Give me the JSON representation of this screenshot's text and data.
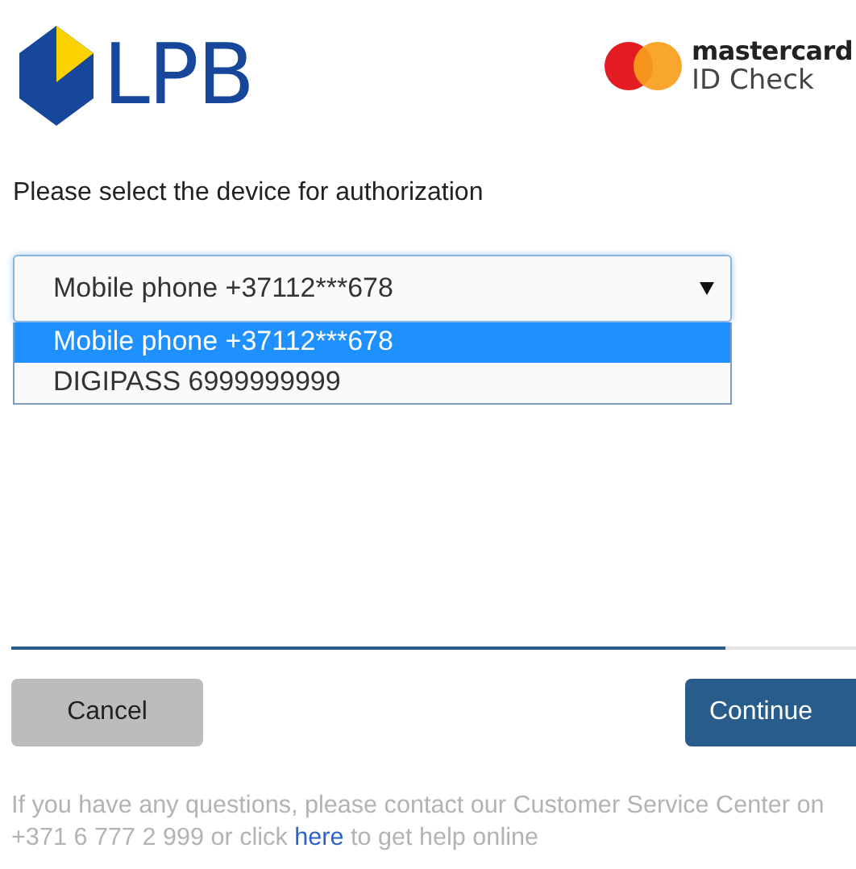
{
  "header": {
    "bank_logo": "LPB",
    "scheme_name": "mastercard",
    "scheme_product": "ID Check"
  },
  "prompt": "Please select the device for authorization",
  "device_select": {
    "value": "Mobile phone +37112***678",
    "expanded": true,
    "options": [
      {
        "label": "Mobile phone +37112***678",
        "selected": true
      },
      {
        "label": "DIGIPASS 6999999999",
        "selected": false
      }
    ]
  },
  "progress": {
    "level": 0.845
  },
  "buttons": {
    "cancel": "Cancel",
    "continue": "Continue"
  },
  "footer": {
    "text_before": "If you have any questions, please contact our Customer Service Center on +371 6 777 2 999 or click",
    "link": "here",
    "text_after": "to get help online"
  }
}
